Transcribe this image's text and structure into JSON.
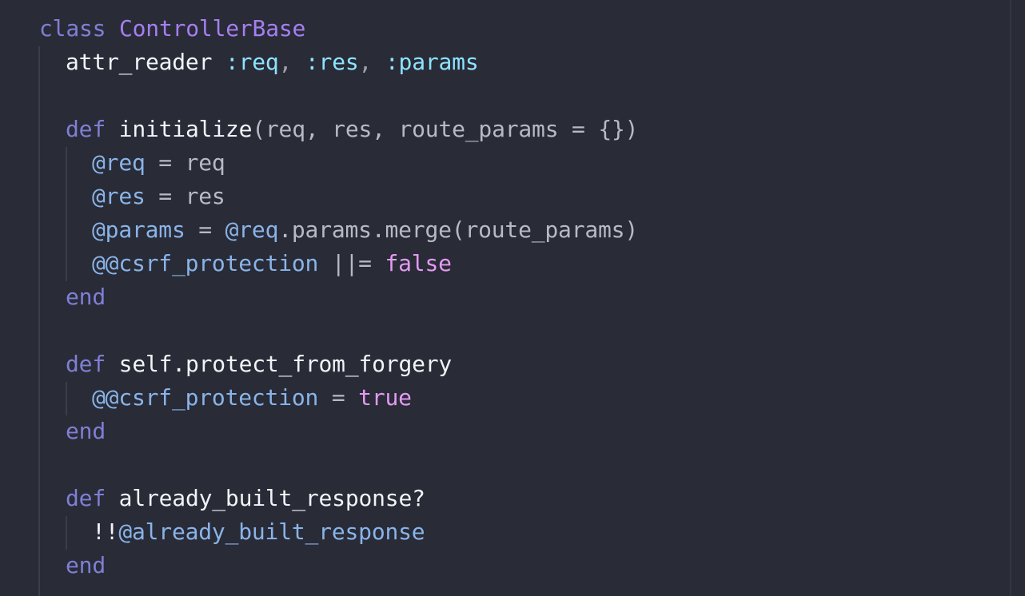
{
  "code": {
    "line1": {
      "kw": "class",
      "name": "ControllerBase"
    },
    "line2": {
      "method": "attr_reader",
      "sym1": ":req",
      "comma1": ",",
      "sym2": ":res",
      "comma2": ",",
      "sym3": ":params"
    },
    "line3": {
      "kw": "def",
      "name": "initialize",
      "args": "(req, res, route_params = {})"
    },
    "line4": {
      "ivar": "@req",
      "rest": " = req"
    },
    "line5": {
      "ivar": "@res",
      "rest": " = res"
    },
    "line6": {
      "ivar": "@params",
      "op": " = ",
      "ivar2": "@req",
      "rest": ".params.merge(route_params)"
    },
    "line7": {
      "cvar": "@@csrf_protection",
      "op": " ||= ",
      "bool": "false"
    },
    "line8": {
      "kw": "end"
    },
    "line9": {
      "kw": "def",
      "name": "self.protect_from_forgery"
    },
    "line10": {
      "cvar": "@@csrf_protection",
      "op": " = ",
      "bool": "true"
    },
    "line11": {
      "kw": "end"
    },
    "line12": {
      "kw": "def",
      "name": "already_built_response?"
    },
    "line13": {
      "prefix": "!!",
      "ivar": "@already_built_response"
    },
    "line14": {
      "kw": "end"
    }
  },
  "colors": {
    "background": "#292b37",
    "keyword": "#7f7fd5",
    "class_name": "#a57ff0",
    "symbol": "#8ee3ff",
    "instance_var": "#89b4e8",
    "boolean": "#e39af2"
  }
}
